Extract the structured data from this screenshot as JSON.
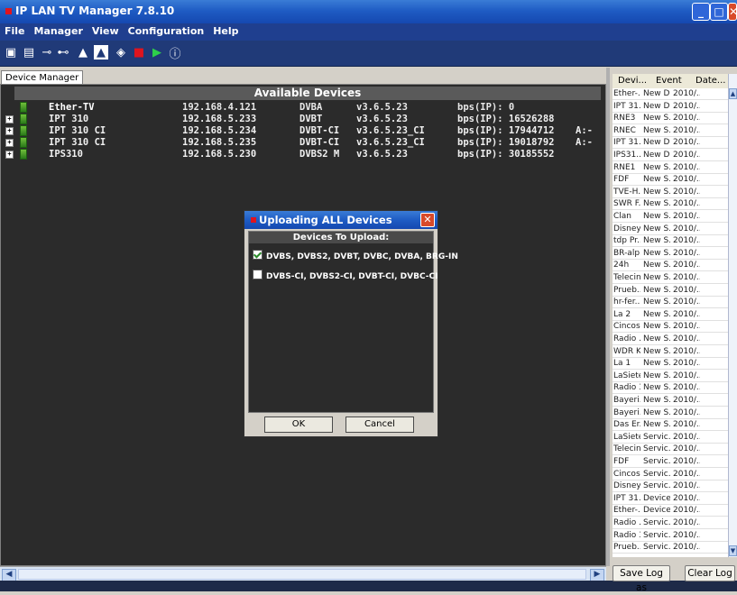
{
  "window": {
    "title": "IP LAN TV Manager 7.8.10"
  },
  "menu": [
    "File",
    "Manager",
    "View",
    "Configuration",
    "Help"
  ],
  "tab": {
    "label": "Device Manager"
  },
  "devices": {
    "header": "Available Devices",
    "rows": [
      {
        "name": "Ether-TV",
        "ip": "192.168.4.121",
        "type": "DVBA",
        "version": "v3.6.5.23",
        "bps": "bps(IP): 0",
        "extra": ""
      },
      {
        "name": "IPT 310",
        "ip": "192.168.5.233",
        "type": "DVBT",
        "version": "v3.6.5.23",
        "bps": "bps(IP): 16526288",
        "extra": ""
      },
      {
        "name": "IPT 310 CI",
        "ip": "192.168.5.234",
        "type": "DVBT-CI",
        "version": "v3.6.5.23_CI",
        "bps": "bps(IP): 17944712",
        "extra": "A:-"
      },
      {
        "name": "IPT 310 CI",
        "ip": "192.168.5.235",
        "type": "DVBT-CI",
        "version": "v3.6.5.23_CI",
        "bps": "bps(IP): 19018792",
        "extra": "A:-"
      },
      {
        "name": "IPS310",
        "ip": "192.168.5.230",
        "type": "DVBS2 M",
        "version": "v3.6.5.23",
        "bps": "bps(IP): 30185552",
        "extra": ""
      }
    ]
  },
  "dialog": {
    "title": "Uploading ALL Devices",
    "subtitle": "Devices To Upload:",
    "options": [
      {
        "label": "DVBS, DVBS2, DVBT, DVBC, DVBA, BRG-IN",
        "checked": true
      },
      {
        "label": "DVBS-CI, DVBS2-CI, DVBT-CI, DVBC-CI",
        "checked": false
      }
    ],
    "ok": "OK",
    "cancel": "Cancel"
  },
  "log": {
    "columns": [
      "Devi...",
      "Event",
      "Date..."
    ],
    "rows": [
      [
        "Ether-...",
        "New D...",
        "2010/..."
      ],
      [
        "IPT 31...",
        "New D...",
        "2010/..."
      ],
      [
        "RNE3",
        "New S...",
        "2010/..."
      ],
      [
        "RNEC",
        "New S...",
        "2010/..."
      ],
      [
        "IPT 31...",
        "New D...",
        "2010/..."
      ],
      [
        "IPS31...",
        "New D...",
        "2010/..."
      ],
      [
        "RNE1",
        "New S...",
        "2010/..."
      ],
      [
        "FDF",
        "New S...",
        "2010/..."
      ],
      [
        "TVE-H...",
        "New S...",
        "2010/..."
      ],
      [
        "SWR F...",
        "New S...",
        "2010/..."
      ],
      [
        "Clan",
        "New S...",
        "2010/..."
      ],
      [
        "Disney...",
        "New S...",
        "2010/..."
      ],
      [
        "tdp Pr...",
        "New S...",
        "2010/..."
      ],
      [
        "BR-alp...",
        "New S...",
        "2010/..."
      ],
      [
        "24h",
        "New S...",
        "2010/..."
      ],
      [
        "Telecinco",
        "New S...",
        "2010/..."
      ],
      [
        "Prueb...",
        "New S...",
        "2010/..."
      ],
      [
        "hr-fer...",
        "New S...",
        "2010/..."
      ],
      [
        "La 2",
        "New S...",
        "2010/..."
      ],
      [
        "Cincos...",
        "New S...",
        "2010/..."
      ],
      [
        "Radio ...",
        "New S...",
        "2010/..."
      ],
      [
        "WDR K...",
        "New S...",
        "2010/..."
      ],
      [
        "La 1",
        "New S...",
        "2010/..."
      ],
      [
        "LaSiete",
        "New S...",
        "2010/..."
      ],
      [
        "Radio 3",
        "New S...",
        "2010/..."
      ],
      [
        "Bayeri...",
        "New S...",
        "2010/..."
      ],
      [
        "Bayeri...",
        "New S...",
        "2010/..."
      ],
      [
        "Das Er...",
        "New S...",
        "2010/..."
      ],
      [
        "LaSiete",
        "Servic...",
        "2010/..."
      ],
      [
        "Telecinco",
        "Servic...",
        "2010/..."
      ],
      [
        "FDF",
        "Servic...",
        "2010/..."
      ],
      [
        "Cincos...",
        "Servic...",
        "2010/..."
      ],
      [
        "Disney...",
        "Servic...",
        "2010/..."
      ],
      [
        "IPT 31...",
        "Device...",
        "2010/..."
      ],
      [
        "Ether-...",
        "Device...",
        "2010/..."
      ],
      [
        "Radio ...",
        "Servic...",
        "2010/..."
      ],
      [
        "Radio 3",
        "Servic...",
        "2010/..."
      ],
      [
        "Prueb...",
        "Servic...",
        "2010/..."
      ]
    ],
    "save_button": "Save Log as",
    "clear_button": "Clear Log"
  }
}
